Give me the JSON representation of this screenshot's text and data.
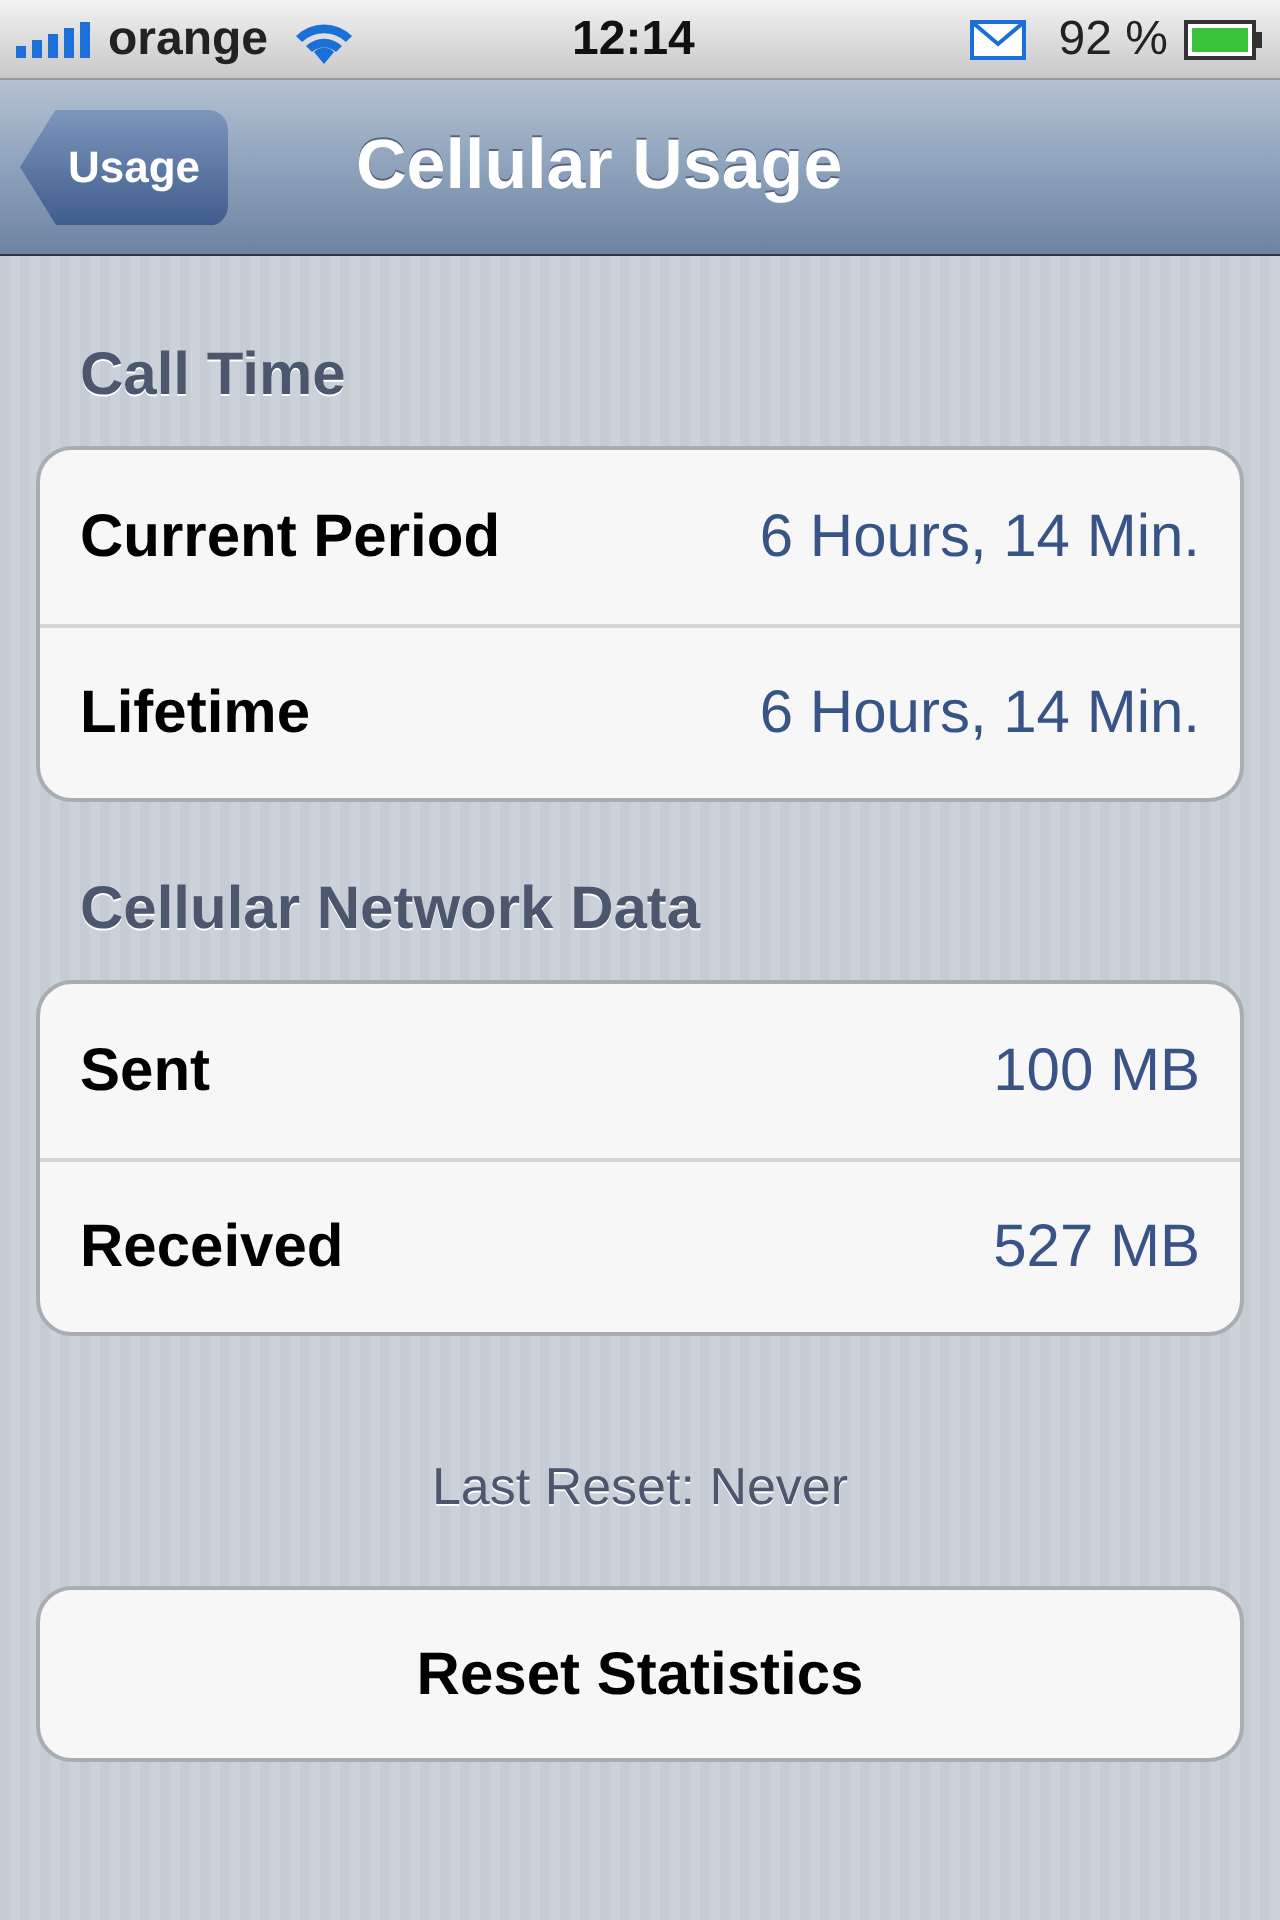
{
  "status_bar": {
    "carrier": "orange",
    "time": "12:14",
    "battery": "92 %"
  },
  "nav_bar": {
    "back_button": "Usage",
    "title": "Cellular Usage"
  },
  "sections": [
    {
      "header": "Call Time",
      "rows": [
        {
          "label": "Current Period",
          "value": "6 Hours, 14 Min."
        },
        {
          "label": "Lifetime",
          "value": "6 Hours, 14 Min."
        }
      ]
    },
    {
      "header": "Cellular Network Data",
      "rows": [
        {
          "label": "Sent",
          "value": "100 MB"
        },
        {
          "label": "Received",
          "value": "527 MB"
        }
      ]
    }
  ],
  "footer_note": "Last Reset: Never",
  "buttons": [
    "Reset Statistics"
  ]
}
